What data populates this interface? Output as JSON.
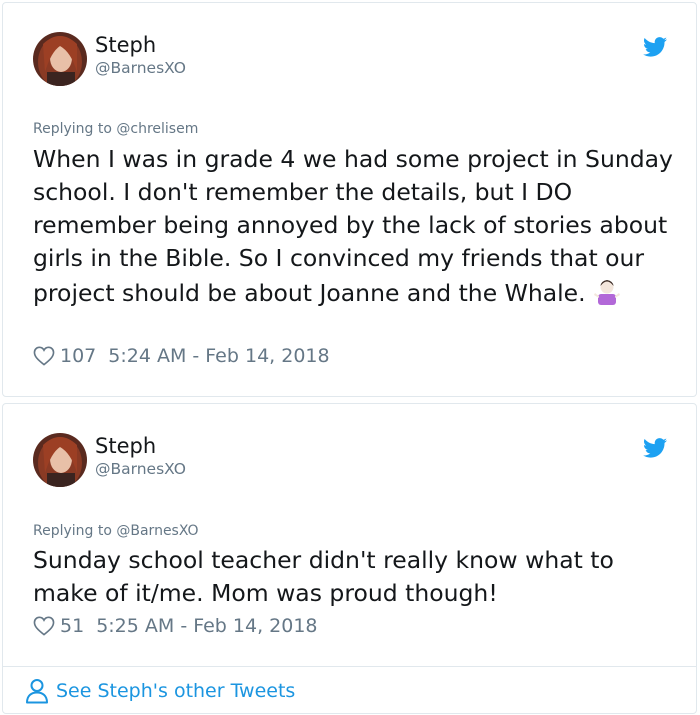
{
  "tweets": [
    {
      "author_name": "Steph",
      "author_handle": "@BarnesXO",
      "replying_to": "Replying to @chrelisem",
      "text": "When I was in grade 4 we had some project in Sunday school. I don't remember the details, but I DO remember being annoyed by the lack of stories about girls in the Bible. So I convinced my friends that our project should be about Joanne and the Whale.",
      "emoji": "person-shrugging-emoji",
      "likes": "107",
      "timestamp": "5:24 AM - Feb 14, 2018"
    },
    {
      "author_name": "Steph",
      "author_handle": "@BarnesXO",
      "replying_to": "Replying to @BarnesXO",
      "text": "Sunday school teacher didn't really know what to make of it/me. Mom was proud though!",
      "likes": "51",
      "timestamp": "5:25 AM - Feb 14, 2018"
    }
  ],
  "footer": {
    "link_label": "See Steph's other Tweets",
    "icon": "person-outline-icon"
  },
  "colors": {
    "text": "#14171a",
    "muted": "#657786",
    "accent": "#1da1f2",
    "link": "#1b95e0",
    "border": "#e1e8ed"
  }
}
